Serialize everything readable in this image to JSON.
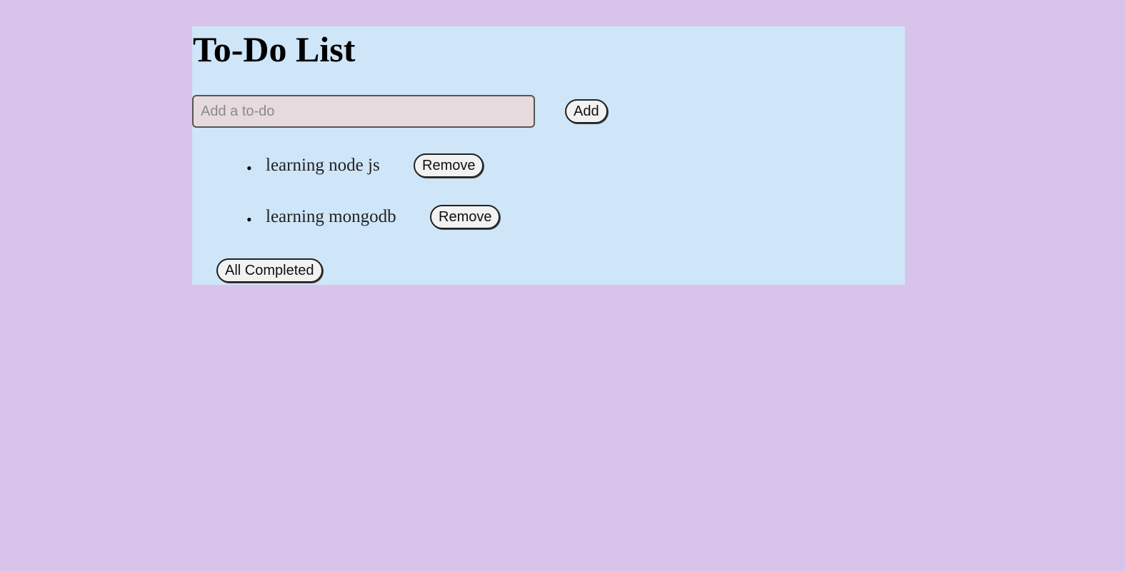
{
  "app": {
    "title": "To-Do List"
  },
  "form": {
    "input_value": "",
    "input_placeholder": "Add a to-do",
    "add_label": "Add"
  },
  "todos": [
    {
      "text": "learning node js",
      "remove_label": "Remove"
    },
    {
      "text": "learning mongodb",
      "remove_label": "Remove"
    }
  ],
  "footer": {
    "all_completed_label": "All Completed"
  },
  "colors": {
    "page_background": "#d8c3ea",
    "card_background": "#cfe5f8",
    "input_background": "#e7dadf"
  }
}
